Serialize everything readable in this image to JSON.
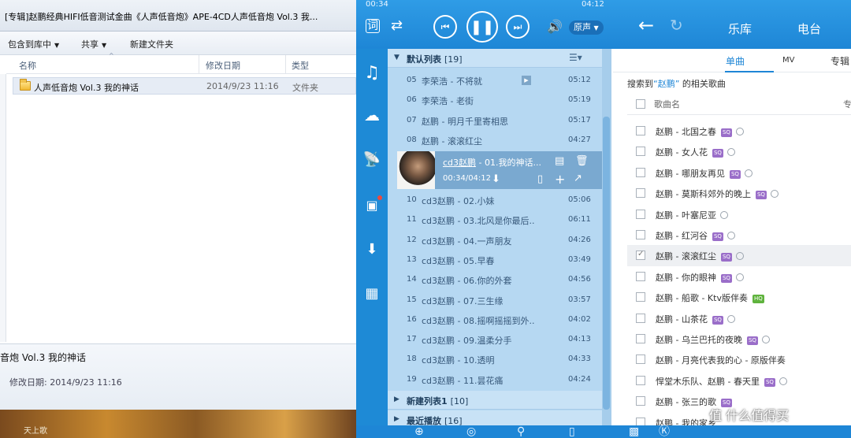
{
  "explorer": {
    "title": "[专辑]赵鹏经典HIFI低音测试金曲《人声低音炮》APE-4CD人声低音炮 Vol.3 我...",
    "toolbar": {
      "library": "包含到库中",
      "share": "共享",
      "new_folder": "新建文件夹"
    },
    "columns": {
      "name": "名称",
      "date": "修改日期",
      "type": "类型"
    },
    "row": {
      "name": "人声低音炮 Vol.3 我的神话",
      "date": "2014/9/23 11:16",
      "type": "文件夹"
    },
    "details": {
      "name": "音炮 Vol.3 我的神话",
      "modified": "修改日期: 2014/9/23 11:16"
    },
    "desktop_label": "天上歌"
  },
  "player": {
    "time_start": "00:34",
    "time_end": "04:12",
    "sound_mode": "原声",
    "nav_tabs": [
      "乐库",
      "电台"
    ],
    "groups": {
      "default": {
        "name": "默认列表",
        "count": "[19]"
      },
      "new": {
        "name": "新建列表1",
        "count": "[10]"
      },
      "recent": {
        "name": "最近播放",
        "count": "[16]"
      }
    },
    "tracks_before": [
      {
        "num": "05",
        "title": "李荣浩 - 不将就",
        "dur": "05:12",
        "mv": "true"
      },
      {
        "num": "06",
        "title": "李荣浩 - 老街",
        "dur": "05:19"
      },
      {
        "num": "07",
        "title": "赵鹏 - 明月千里寄相思",
        "dur": "05:17"
      },
      {
        "num": "08",
        "title": "赵鹏 - 滚滚红尘",
        "dur": "04:27"
      }
    ],
    "now_playing": {
      "artist": "cd3赵鹏",
      "title": " - 01.我的神话...",
      "time": "00:34/04:12"
    },
    "tracks_after": [
      {
        "num": "10",
        "title": "cd3赵鹏 - 02.小妹",
        "dur": "05:06"
      },
      {
        "num": "11",
        "title": "cd3赵鹏 - 03.北风是你最后..",
        "dur": "06:11"
      },
      {
        "num": "12",
        "title": "cd3赵鹏 - 04.一声朋友",
        "dur": "04:26"
      },
      {
        "num": "13",
        "title": "cd3赵鹏 - 05.早春",
        "dur": "03:49"
      },
      {
        "num": "14",
        "title": "cd3赵鹏 - 06.你的外套",
        "dur": "04:56"
      },
      {
        "num": "15",
        "title": "cd3赵鹏 - 07.三生缘",
        "dur": "03:57"
      },
      {
        "num": "16",
        "title": "cd3赵鹏 - 08.摇啊摇摇到外..",
        "dur": "04:02"
      },
      {
        "num": "17",
        "title": "cd3赵鹏 - 09.温柔分手",
        "dur": "04:13"
      },
      {
        "num": "18",
        "title": "cd3赵鹏 - 10.透明",
        "dur": "04:33"
      },
      {
        "num": "19",
        "title": "cd3赵鹏 - 11.昙花痛",
        "dur": "04:24"
      }
    ]
  },
  "library": {
    "tabs": [
      "单曲",
      "MV",
      "专辑"
    ],
    "search": {
      "prefix": "搜索到",
      "keyword": "“赵鹏”",
      "suffix": " 的相关歌曲"
    },
    "head": {
      "label": "歌曲名",
      "col2": "专"
    },
    "songs": [
      {
        "name": "赵鹏 - 北国之春",
        "badge": "SQ",
        "globe": true
      },
      {
        "name": "赵鹏 - 女人花",
        "badge": "SQ",
        "globe": true
      },
      {
        "name": "赵鹏 - 哪朋友再见",
        "badge": "SQ",
        "globe": true
      },
      {
        "name": "赵鹏 - 莫斯科郊外的晚上",
        "badge": "SQ",
        "globe": true
      },
      {
        "name": "赵鹏 - 叶塞尼亚",
        "badge": "",
        "globe": true
      },
      {
        "name": "赵鹏 - 红河谷",
        "badge": "SQ",
        "globe": true
      },
      {
        "name": "赵鹏 - 滚滚红尘",
        "badge": "SQ",
        "globe": true,
        "selected": true
      },
      {
        "name": "赵鹏 - 你的眼神",
        "badge": "SQ",
        "globe": true
      },
      {
        "name": "赵鹏 - 船歌 - Ktv版伴奏",
        "badge": "HQ",
        "globe": false
      },
      {
        "name": "赵鹏 - 山茶花",
        "badge": "SQ",
        "globe": true
      },
      {
        "name": "赵鹏 - 乌兰巴托的夜晚",
        "badge": "SQ",
        "globe": true
      },
      {
        "name": "赵鹏 - 月亮代表我的心 - 原版伴奏",
        "badge": "",
        "globe": false
      },
      {
        "name": "悍堂木乐队、赵鹏 - 春天里",
        "badge": "SQ",
        "globe": true
      },
      {
        "name": "赵鹏 - 张三的歌",
        "badge": "SQ",
        "globe": false
      },
      {
        "name": "赵鹏 - 我的家乡",
        "badge": "",
        "globe": false
      }
    ]
  },
  "watermark": "值 什么值得买"
}
